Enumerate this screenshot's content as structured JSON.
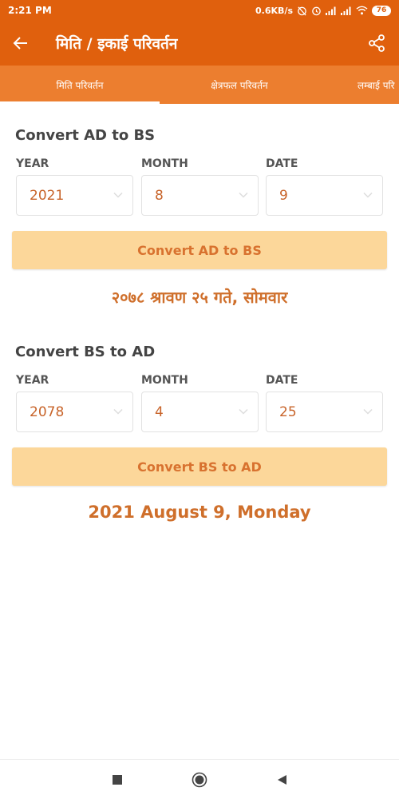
{
  "status_bar": {
    "time": "2:21 PM",
    "speed": "0.6KB/s",
    "battery": "76",
    "icons": [
      "alarm-off-icon",
      "alarm-icon",
      "signal-icon",
      "signal-icon",
      "wifi-icon",
      "battery-icon"
    ]
  },
  "app_bar": {
    "title": "मिति / इकाई  परिवर्तन",
    "back_icon": "arrow-left-icon",
    "share_icon": "share-icon"
  },
  "tabs": [
    {
      "label": "मिति परिवर्तन",
      "selected": true
    },
    {
      "label": "क्षेत्रफल परिवर्तन",
      "selected": false
    },
    {
      "label": "लम्बाई परि",
      "selected": false
    }
  ],
  "ad_to_bs": {
    "title": "Convert AD to BS",
    "year_label": "YEAR",
    "month_label": "MONTH",
    "date_label": "DATE",
    "year_value": "2021",
    "month_value": "8",
    "date_value": "9",
    "button_label": "Convert AD to BS",
    "result": "२०७८ श्रावण २५ गते, सोमवार"
  },
  "bs_to_ad": {
    "title": "Convert BS to AD",
    "year_label": "YEAR",
    "month_label": "MONTH",
    "date_label": "DATE",
    "year_value": "2078",
    "month_value": "4",
    "date_value": "25",
    "button_label": "Convert BS to AD",
    "result": "2021 August 9, Monday"
  },
  "colors": {
    "app_bar": "#e0600d",
    "tab_bar": "#ec7e2f",
    "button_bg": "#fcd79a",
    "accent_text": "#cf6f2b"
  }
}
